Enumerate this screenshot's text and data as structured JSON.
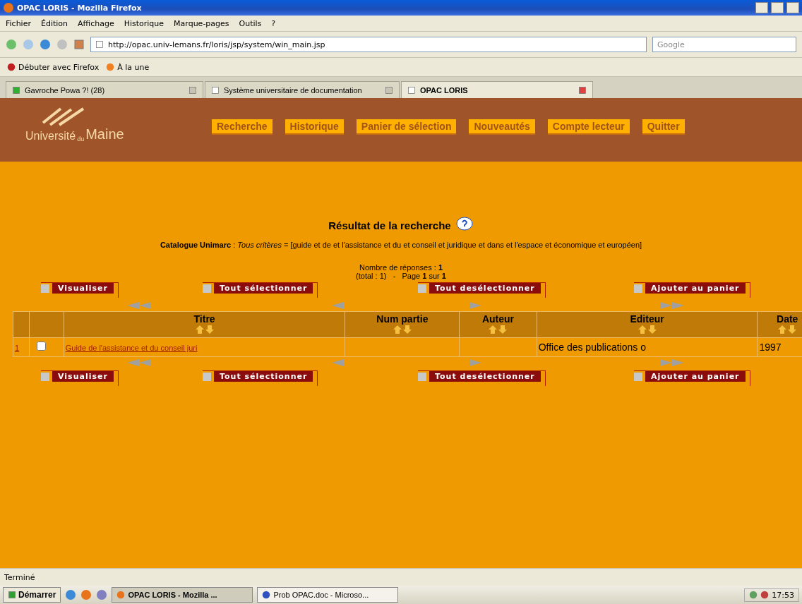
{
  "window": {
    "title": "OPAC LORIS - Mozilla Firefox"
  },
  "menu": [
    "Fichier",
    "Édition",
    "Affichage",
    "Historique",
    "Marque-pages",
    "Outils",
    "?"
  ],
  "navbar": {
    "url": "http://opac.univ-lemans.fr/loris/jsp/system/win_main.jsp",
    "search_placeholder": "Google"
  },
  "bookmarks": [
    "Débuter avec Firefox",
    "À la une"
  ],
  "tabs": [
    {
      "label": "Gavroche Powa ?! (28)",
      "selected": false
    },
    {
      "label": "Système universitaire de documentation",
      "selected": false
    },
    {
      "label": "OPAC LORIS",
      "selected": true
    }
  ],
  "site": {
    "logo": {
      "word1": "Université",
      "word2": "du",
      "word3": "Maine"
    },
    "nav_links": [
      "Recherche",
      "Historique",
      "Panier de sélection",
      "Nouveautés",
      "Compte lecteur",
      "Quitter"
    ]
  },
  "result": {
    "title": "Résultat de la recherche",
    "criteria": "**Catalogue Unimarc** : *Tous critères* = [guide et de et l'assistance et du et conseil et juridique et dans et l'espace et économique et européen]",
    "count": "Nombre de réponses : **1**",
    "pages": "(total : 1)   -   Page **1** sur **1**",
    "actions_top": [
      "Visualiser",
      "Tout sélectionner",
      "Tout desélectionner",
      "Ajouter au panier"
    ],
    "actions_bottom": [
      "Visualiser",
      "Tout sélectionner",
      "Tout desélectionner",
      "Ajouter au panier"
    ],
    "table": {
      "columns": [
        "Titre",
        "Num partie",
        "Auteur",
        "Editeur",
        "Date"
      ],
      "rows": [
        {
          "index": "1",
          "checked": false,
          "cells": [
            "Guide de l'assistance et du conseil juri",
            "",
            "",
            "Office des publications o",
            "1997"
          ]
        }
      ]
    }
  },
  "status_bar": "Terminé",
  "taskbar": {
    "start": "Démarrer",
    "tasks": [
      {
        "label": "OPAC LORIS - Mozilla ...",
        "selected": true
      },
      {
        "label": "Prob OPAC.doc - Microso...",
        "selected": false
      }
    ],
    "clock": "17:53"
  }
}
